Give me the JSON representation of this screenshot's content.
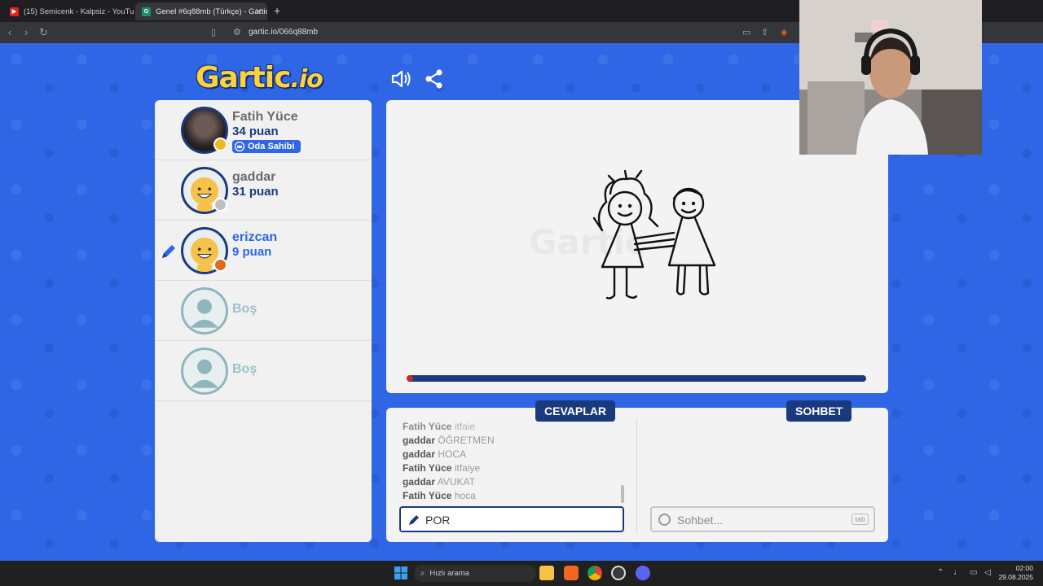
{
  "browser": {
    "tabs": [
      {
        "label": "(15) Semicenk - Kalpsiz - YouTub",
        "favicon_color": "#e62117"
      },
      {
        "label": "Genel #6q88mb (Türkçe) - Gartic",
        "favicon_color": "#1f8f6a",
        "favicon_letter": "G"
      }
    ],
    "url": "gartic.io/066q88mb"
  },
  "header": {
    "logo_main": "Gartic",
    "logo_suffix": ".io"
  },
  "players": [
    {
      "name": "Fatih Yüce",
      "score": "34 puan",
      "badge": "Oda Sahibi",
      "status_color": "#f2b824",
      "avatar": "photo",
      "drawing": false
    },
    {
      "name": "gaddar",
      "score": "31 puan",
      "status_color": "#c0c0c0",
      "avatar": "smiley",
      "drawing": false
    },
    {
      "name": "erizcan",
      "score": "9 puan",
      "status_color": "#e06a1b",
      "avatar": "smiley",
      "drawing": true
    },
    {
      "name": "Boş",
      "avatar": "empty"
    },
    {
      "name": "Boş",
      "avatar": "empty"
    }
  ],
  "canvas": {
    "watermark": "Gartic",
    "timer_fraction": 0.01
  },
  "answers_panel": {
    "tab_label": "CEVAPLAR",
    "items": [
      {
        "user": "Fatih Yüce",
        "text": "itfaie",
        "faded": true
      },
      {
        "user": "gaddar",
        "text": "ÖĞRETMEN"
      },
      {
        "user": "gaddar",
        "text": "HOCA"
      },
      {
        "user": "Fatih Yüce",
        "text": "itfaiye"
      },
      {
        "user": "gaddar",
        "text": "AVUKAT"
      },
      {
        "user": "Fatih Yüce",
        "text": "hoca"
      }
    ],
    "input_value": "POR"
  },
  "chat_panel": {
    "tab_label": "SOHBET",
    "placeholder": "Sohbet...",
    "shortcut": "tab"
  },
  "taskbar": {
    "search_placeholder": "Hızlı arama",
    "time": "02:00",
    "date": "29.08.2025"
  },
  "colors": {
    "background_blue": "#2f66e6",
    "navy": "#1b3a7e",
    "logo_yellow": "#ffd23a"
  }
}
